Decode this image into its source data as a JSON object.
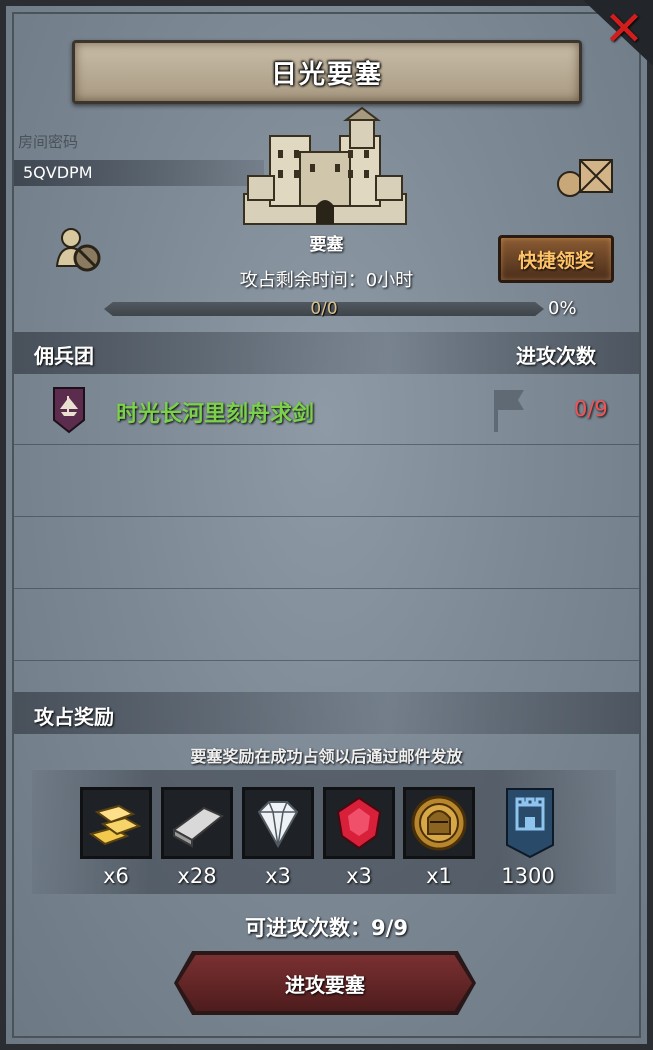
{
  "title": "日光要塞",
  "room": {
    "label": "房间密码",
    "code": "5QVDPM"
  },
  "fortress": {
    "label": "要塞"
  },
  "quick_claim_label": "快捷领奖",
  "remaining_time": "攻占剩余时间：0小时",
  "progress": {
    "text": "0/0",
    "percent_label": "0%",
    "fraction": 0
  },
  "mercenary": {
    "section_title": "佣兵团",
    "count_header": "进攻次数",
    "rows": [
      {
        "name": "时光长河里刻舟求剑",
        "attacks": "0/9"
      }
    ]
  },
  "rewards": {
    "section_title": "攻占奖励",
    "note": "要塞奖励在成功占领以后通过邮件发放",
    "items": [
      {
        "icon": "gold-bars-icon",
        "qty": "x6"
      },
      {
        "icon": "silver-ingot-icon",
        "qty": "x28"
      },
      {
        "icon": "diamond-icon",
        "qty": "x3"
      },
      {
        "icon": "ruby-icon",
        "qty": "x3"
      },
      {
        "icon": "knight-medal-icon",
        "qty": "x1"
      },
      {
        "icon": "fortress-banner-icon",
        "qty": "1300"
      }
    ]
  },
  "available_attacks": "可进攻次数：9/9",
  "attack_button_label": "进攻要塞",
  "colors": {
    "merc_name": "#7bd14a",
    "attack_count": "#f05454",
    "quick_claim_text": "#ffc266",
    "close": "#d11d1d"
  }
}
